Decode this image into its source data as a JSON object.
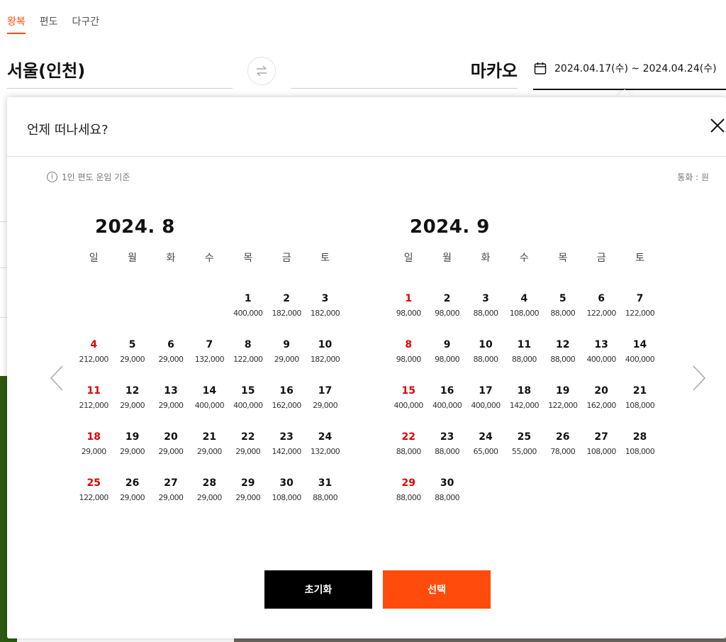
{
  "tabs": [
    "왕복",
    "편도",
    "다구간"
  ],
  "route": {
    "origin": "서울(인천)",
    "destination": "마카오",
    "date_range": "2024.04.17(수) ~ 2024.04.24(수)"
  },
  "modal": {
    "title": "언제 떠나세요?",
    "info": "1인 편도 운임 기준",
    "info_icon": "i",
    "currency": "통화 : 원",
    "weekdays": [
      "일",
      "월",
      "화",
      "수",
      "목",
      "금",
      "토"
    ],
    "months": [
      {
        "title": "2024. 8",
        "offset": 4,
        "days": [
          [
            "1",
            "400,000"
          ],
          [
            "2",
            "182,000"
          ],
          [
            "3",
            "182,000"
          ],
          [
            "4",
            "212,000"
          ],
          [
            "5",
            "29,000"
          ],
          [
            "6",
            "29,000"
          ],
          [
            "7",
            "132,000"
          ],
          [
            "8",
            "122,000"
          ],
          [
            "9",
            "29,000"
          ],
          [
            "10",
            "182,000"
          ],
          [
            "11",
            "212,000"
          ],
          [
            "12",
            "29,000"
          ],
          [
            "13",
            "29,000"
          ],
          [
            "14",
            "400,000"
          ],
          [
            "15",
            "400,000"
          ],
          [
            "16",
            "162,000"
          ],
          [
            "17",
            "29,000"
          ],
          [
            "18",
            "29,000"
          ],
          [
            "19",
            "29,000"
          ],
          [
            "20",
            "29,000"
          ],
          [
            "21",
            "29,000"
          ],
          [
            "22",
            "29,000"
          ],
          [
            "23",
            "142,000"
          ],
          [
            "24",
            "132,000"
          ],
          [
            "25",
            "122,000"
          ],
          [
            "26",
            "29,000"
          ],
          [
            "27",
            "29,000"
          ],
          [
            "28",
            "29,000"
          ],
          [
            "29",
            "29,000"
          ],
          [
            "30",
            "108,000"
          ],
          [
            "31",
            "88,000"
          ]
        ]
      },
      {
        "title": "2024. 9",
        "offset": 0,
        "days": [
          [
            "1",
            "98,000"
          ],
          [
            "2",
            "98,000"
          ],
          [
            "3",
            "88,000"
          ],
          [
            "4",
            "108,000"
          ],
          [
            "5",
            "88,000"
          ],
          [
            "6",
            "122,000"
          ],
          [
            "7",
            "122,000"
          ],
          [
            "8",
            "98,000"
          ],
          [
            "9",
            "98,000"
          ],
          [
            "10",
            "88,000"
          ],
          [
            "11",
            "88,000"
          ],
          [
            "12",
            "88,000"
          ],
          [
            "13",
            "400,000"
          ],
          [
            "14",
            "400,000"
          ],
          [
            "15",
            "400,000"
          ],
          [
            "16",
            "400,000"
          ],
          [
            "17",
            "400,000"
          ],
          [
            "18",
            "142,000"
          ],
          [
            "19",
            "122,000"
          ],
          [
            "20",
            "162,000"
          ],
          [
            "21",
            "108,000"
          ],
          [
            "22",
            "88,000"
          ],
          [
            "23",
            "88,000"
          ],
          [
            "24",
            "65,000"
          ],
          [
            "25",
            "55,000"
          ],
          [
            "26",
            "78,000"
          ],
          [
            "27",
            "108,000"
          ],
          [
            "28",
            "108,000"
          ],
          [
            "29",
            "88,000"
          ],
          [
            "30",
            "88,000"
          ]
        ]
      }
    ],
    "reset_label": "초기화",
    "select_label": "선택"
  },
  "colors": {
    "accent": "#ff4b0b",
    "sunday": "#e00000",
    "reset_bg": "#000000"
  },
  "icons": {
    "close": "close-icon",
    "calendar": "calendar-icon",
    "swap": "swap-icon",
    "prev": "chevron-left-icon",
    "next": "chevron-right-icon"
  }
}
